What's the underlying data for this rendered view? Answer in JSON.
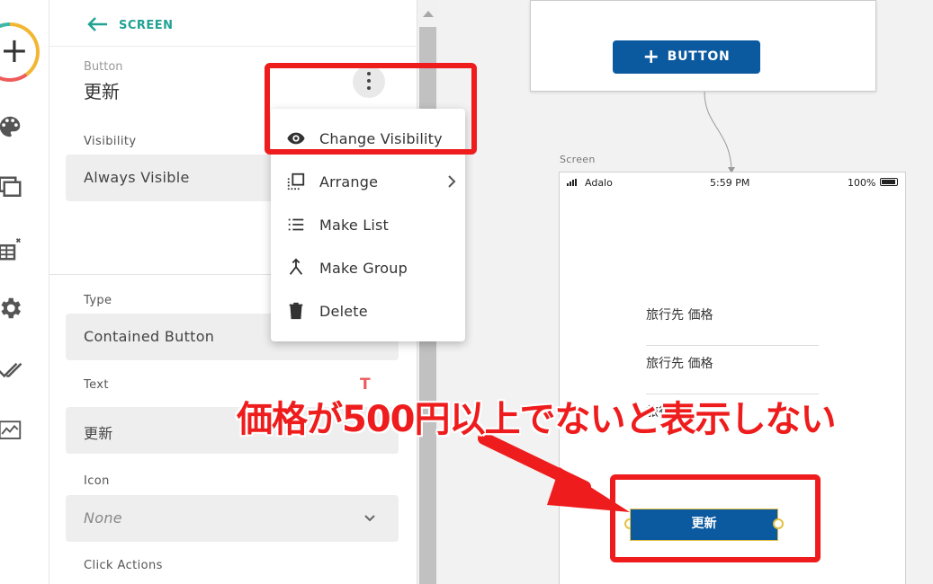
{
  "panel": {
    "back_label": "SCREEN",
    "component_type": "Button",
    "component_name": "更新",
    "visibility_label": "Visibility",
    "visibility_value": "Always Visible",
    "type_label": "Type",
    "type_value": "Contained Button",
    "text_label": "Text",
    "text_value": "更新",
    "icon_label": "Icon",
    "icon_value": "None",
    "click_actions_label": "Click Actions"
  },
  "menu": {
    "items": [
      {
        "label": "Change Visibility",
        "icon": "eye-icon"
      },
      {
        "label": "Arrange",
        "icon": "arrange-icon"
      },
      {
        "label": "Make List",
        "icon": "list-icon"
      },
      {
        "label": "Make Group",
        "icon": "merge-icon"
      },
      {
        "label": "Delete",
        "icon": "trash-icon"
      }
    ]
  },
  "canvas": {
    "top_button_label": "BUTTON",
    "screen_label": "Screen",
    "status_carrier": "Adalo",
    "status_time": "5:59 PM",
    "status_battery": "100%",
    "list_items": [
      "旅行先 価格",
      "旅行先 価格",
      "旅行先"
    ],
    "update_button_label": "更新"
  },
  "annotation": {
    "caption": "価格が500円以上でないと表示しない"
  },
  "colors": {
    "accent_teal": "#21a293",
    "button_blue": "#0b5aa0",
    "annotation_red": "#ee1c1c",
    "selection_yellow": "#e4c041"
  }
}
